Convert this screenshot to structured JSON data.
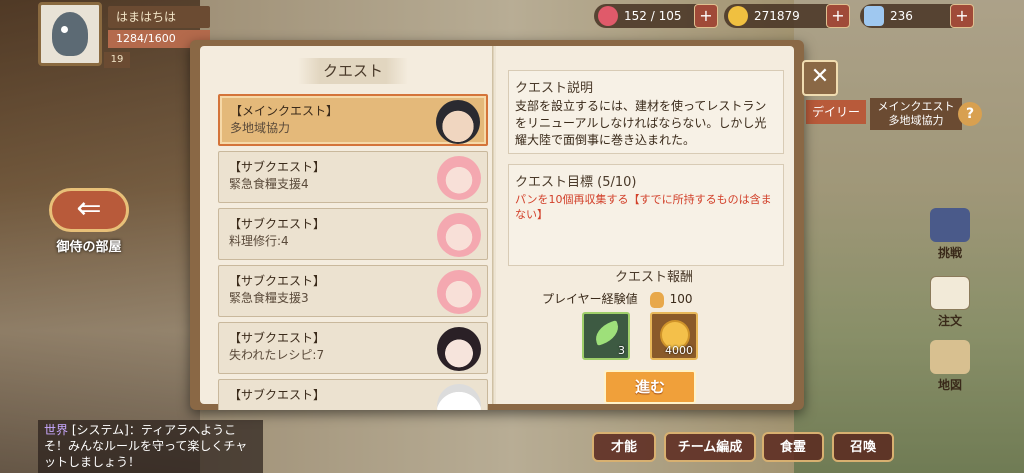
{
  "player": {
    "name": "はまはちは",
    "exp": "1284/1600",
    "level": "19"
  },
  "resources": {
    "stamina": "152 / 105",
    "coins": "271879",
    "gems": "236",
    "plus": "+"
  },
  "left_nav": {
    "room_label": "御侍の部屋",
    "arrow": "⇐"
  },
  "chat": {
    "channel": "世界",
    "message": "[システム]：ティアラへようこそ！みんなルールを守って楽しくチャットしましょう！"
  },
  "bottom_nav": {
    "talent": "才能",
    "team": "チーム編成",
    "food": "食霊",
    "summon": "召喚"
  },
  "right_nav": {
    "challenge": "挑戦",
    "order": "注文",
    "map": "地図",
    "daily_tag": "デイリー",
    "main_tag_line1": "メインクエスト",
    "main_tag_line2": "多地域協力",
    "help": "?"
  },
  "book": {
    "title": "クエスト",
    "quests": [
      {
        "type": "【メインクエスト】",
        "name": "多地域協力",
        "face": "man",
        "active": true
      },
      {
        "type": "【サブクエスト】",
        "name": "緊急食糧支援4",
        "face": "pink",
        "active": false
      },
      {
        "type": "【サブクエスト】",
        "name": "料理修行:4",
        "face": "pink",
        "active": false
      },
      {
        "type": "【サブクエスト】",
        "name": "緊急食糧支援3",
        "face": "pink",
        "active": false
      },
      {
        "type": "【サブクエスト】",
        "name": "失われたレシピ:7",
        "face": "dark",
        "active": false
      },
      {
        "type": "【サブクエスト】",
        "name": "",
        "face": "white",
        "active": false
      }
    ],
    "desc_title": "クエスト説明",
    "desc_text": "支部を設立するには、建材を使ってレストランをリニューアルしなければならない。しかし光耀大陸で面倒事に巻き込まれた。",
    "goal_title": "クエスト目標 (5/10)",
    "goal_text": "パンを10個再収集する【すでに所持するものは含まない】",
    "reward_title": "クエスト報酬",
    "xp_label": "プレイヤー経験値",
    "xp_value": "100",
    "reward_leaf_count": "3",
    "reward_coin_count": "4000",
    "go_button": "進む",
    "close": "✕"
  }
}
